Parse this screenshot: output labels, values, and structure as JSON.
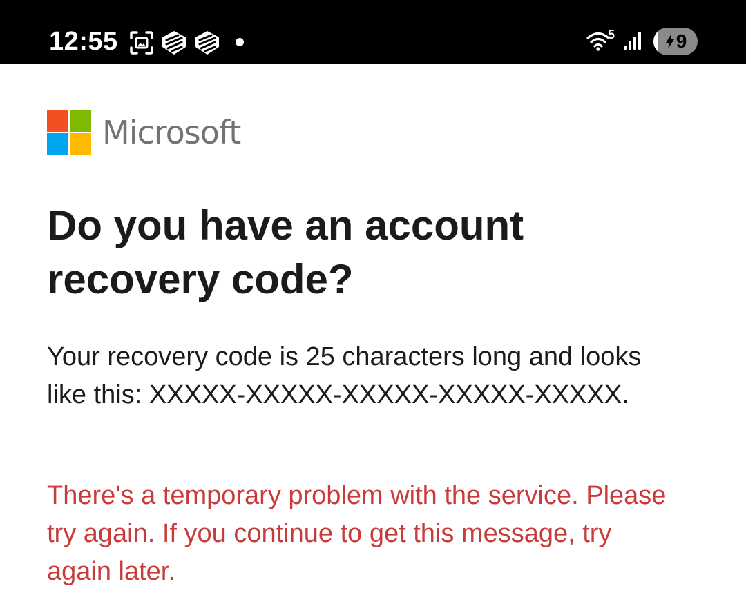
{
  "status_bar": {
    "time": "12:55",
    "wifi_generation": "5",
    "battery_level": "9",
    "battery_percent": 9,
    "icons": [
      "screenshot-icon",
      "app-notification-icon",
      "app-notification-icon",
      "notification-dot-icon",
      "wifi-icon",
      "cellular-signal-icon",
      "battery-charging-icon"
    ]
  },
  "brand": {
    "name": "Microsoft",
    "colors": {
      "red": "#f25022",
      "green": "#7fba00",
      "blue": "#00a4ef",
      "yellow": "#ffb900",
      "wordmark": "#737373"
    }
  },
  "page": {
    "title": "Do you have an account recovery code?",
    "description": "Your recovery code is 25 characters long and looks like this: XXXXX-XXXXX-XXXXX-XXXXX-XXXXX.",
    "error_message": "There's a temporary problem with the service. Please try again. If you continue to get this message, try again later.",
    "error_color": "#c93a3a"
  }
}
